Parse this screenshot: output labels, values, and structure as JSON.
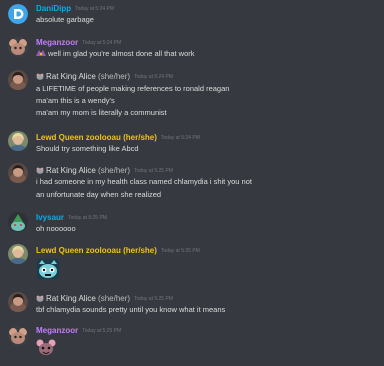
{
  "colors": {
    "background": "#36393f",
    "text": "#dcddde",
    "timestamp": "#72767d",
    "name_blue": "#00b0f4",
    "name_purple": "#c27cff",
    "name_yellow": "#f1c40f",
    "name_gray": "#dcddde"
  },
  "messages": [
    {
      "name": "DaniDipp",
      "time": "Today at 5:24 PM",
      "lines": [
        "absolute garbage"
      ]
    },
    {
      "name": "Meganzoor",
      "time": "Today at 5:24 PM",
      "lines": [
        "well im glad you're almost done all that work"
      ]
    },
    {
      "name": "Rat King Alice",
      "tag": "(she/her)",
      "time": "Today at 5:24 PM",
      "lines": [
        "a LIFETIME of people making references to ronald reagan",
        "ma'am this is a wendy's",
        "ma'am my mom is literally a communist"
      ]
    },
    {
      "name": "Lewd Queen zoolooau (her/she)",
      "time": "Today at 5:24 PM",
      "lines": [
        "Should try something like Abcd"
      ]
    },
    {
      "name": "Rat King Alice",
      "tag": "(she/her)",
      "time": "Today at 5:25 PM",
      "lines": [
        "i had someone in my health class named chlamydia i shit you not",
        "an unfortunate day when she realized"
      ]
    },
    {
      "name": "Ivysaur",
      "time": "Today at 5:25 PM",
      "lines": [
        "oh noooooo"
      ]
    },
    {
      "name": "Lewd Queen zoolooau (her/she)",
      "time": "Today at 5:25 PM",
      "lines": []
    },
    {
      "name": "Rat King Alice",
      "tag": "(she/her)",
      "time": "Today at 5:25 PM",
      "lines": [
        "tbf chlamydia sounds pretty until you know what it means"
      ]
    },
    {
      "name": "Meganzoor",
      "time": "Today at 5:25 PM",
      "lines": []
    }
  ]
}
